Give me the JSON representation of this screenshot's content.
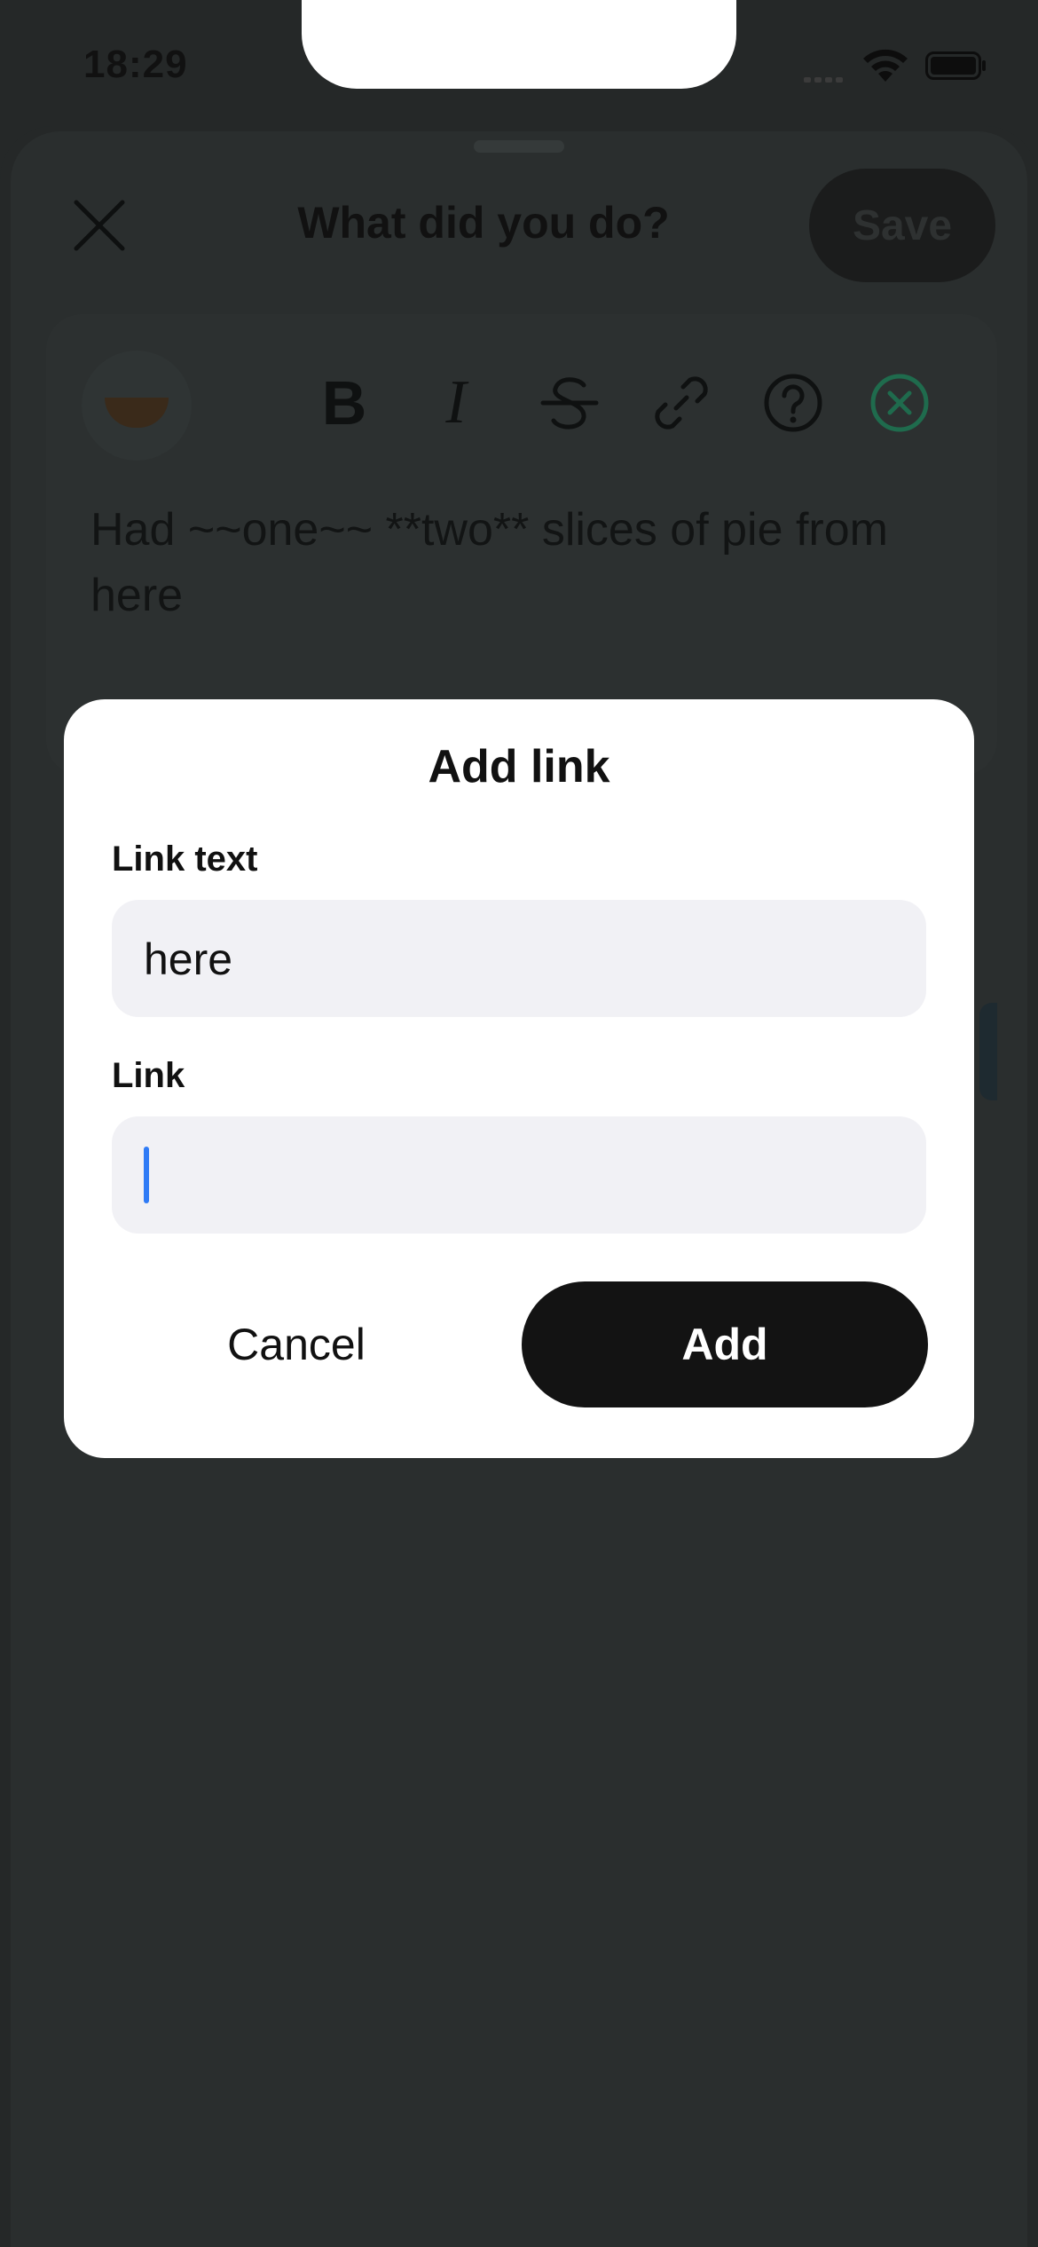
{
  "status_bar": {
    "time": "18:29"
  },
  "header": {
    "title": "What did you do?",
    "save_label": "Save"
  },
  "toolbar": {
    "bold": "B",
    "italic": "I"
  },
  "editor": {
    "text": "Had ~~one~~ **two** slices of pie from here"
  },
  "dialog": {
    "title": "Add link",
    "link_text_label": "Link text",
    "link_text_value": "here",
    "link_label": "Link",
    "link_value": "",
    "cancel_label": "Cancel",
    "add_label": "Add"
  },
  "colors": {
    "overlay": "#252828",
    "dialog_bg": "#ffffff",
    "field_bg": "#f1f1f5",
    "primary_button": "#131313",
    "caret": "#2f7bf6",
    "clear_icon": "#1f6b4d"
  }
}
